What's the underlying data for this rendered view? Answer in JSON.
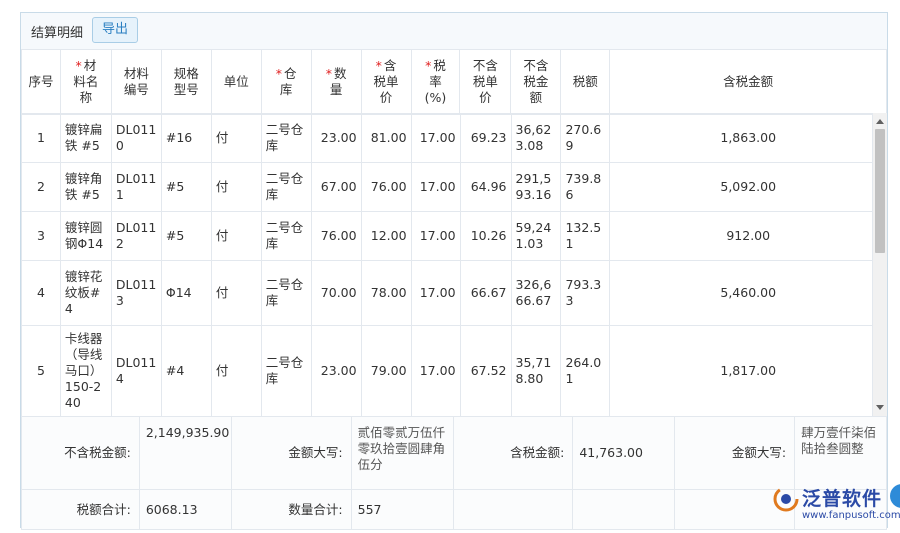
{
  "toolbar": {
    "title": "结算明细",
    "export_label": "导出"
  },
  "columns": [
    {
      "key": "seq",
      "label": "序号",
      "required": false
    },
    {
      "key": "name",
      "label": "材\n料名\n称",
      "required": true
    },
    {
      "key": "code",
      "label": "材料\n编号",
      "required": false
    },
    {
      "key": "spec",
      "label": "规格\n型号",
      "required": false
    },
    {
      "key": "unit",
      "label": "单位",
      "required": false
    },
    {
      "key": "warehouse",
      "label": "仓\n库",
      "required": true
    },
    {
      "key": "qty",
      "label": "数\n量",
      "required": true
    },
    {
      "key": "price_tax",
      "label": "含\n税单\n价",
      "required": true
    },
    {
      "key": "tax_rate",
      "label": "税\n率\n(%)",
      "required": true
    },
    {
      "key": "price_notax",
      "label": "不含\n税单\n价",
      "required": false
    },
    {
      "key": "amount_notax",
      "label": "不含\n税金\n额",
      "required": false
    },
    {
      "key": "tax",
      "label": "税额",
      "required": false
    },
    {
      "key": "amount_tax",
      "label": "含税金额",
      "required": false
    }
  ],
  "rows": [
    {
      "seq": "1",
      "name": "镀锌扁\n铁 #5",
      "code": "DL011\n0",
      "spec": "#16",
      "unit": "付",
      "warehouse": "二号仓\n库",
      "qty": "23.00",
      "price_tax": "81.00",
      "tax_rate": "17.00",
      "price_notax": "69.23",
      "amount_notax": "36,62\n3.08",
      "tax": "270.6\n9",
      "amount_tax": "1,863.00"
    },
    {
      "seq": "2",
      "name": "镀锌角\n铁 #5",
      "code": "DL011\n1",
      "spec": "#5",
      "unit": "付",
      "warehouse": "二号仓\n库",
      "qty": "67.00",
      "price_tax": "76.00",
      "tax_rate": "17.00",
      "price_notax": "64.96",
      "amount_notax": "291,5\n93.16",
      "tax": "739.8\n6",
      "amount_tax": "5,092.00"
    },
    {
      "seq": "3",
      "name": "镀锌圆\n钢Φ14",
      "code": "DL011\n2",
      "spec": "#5",
      "unit": "付",
      "warehouse": "二号仓\n库",
      "qty": "76.00",
      "price_tax": "12.00",
      "tax_rate": "17.00",
      "price_notax": "10.26",
      "amount_notax": "59,24\n1.03",
      "tax": "132.5\n1",
      "amount_tax": "912.00"
    },
    {
      "seq": "4",
      "name": "镀锌花\n纹板#\n4",
      "code": "DL011\n3",
      "spec": "Φ14",
      "unit": "付",
      "warehouse": "二号仓\n库",
      "qty": "70.00",
      "price_tax": "78.00",
      "tax_rate": "17.00",
      "price_notax": "66.67",
      "amount_notax": "326,6\n66.67",
      "tax": "793.3\n3",
      "amount_tax": "5,460.00"
    },
    {
      "seq": "5",
      "name": "卡线器\n（导线\n马口）\n150-2\n40",
      "code": "DL011\n4",
      "spec": "#4",
      "unit": "付",
      "warehouse": "二号仓\n库",
      "qty": "23.00",
      "price_tax": "79.00",
      "tax_rate": "17.00",
      "price_notax": "67.52",
      "amount_notax": "35,71\n8.80",
      "tax": "264.0\n1",
      "amount_tax": "1,817.00"
    }
  ],
  "summary": {
    "notax_label": "不含税金额:",
    "notax_value": "2,149,935.90",
    "caps1_label": "金额大写:",
    "caps1_value": "贰佰零贰万伍仟零玖拾壹圆肆角伍分",
    "tax_amount_label": "含税金额:",
    "tax_amount_value": "41,763.00",
    "caps2_label": "金额大写:",
    "caps2_value": "肆万壹仟柒佰陆拾叁圆整",
    "tax_total_label": "税额合计:",
    "tax_total_value": "6068.13",
    "qty_total_label": "数量合计:",
    "qty_total_value": "557"
  },
  "logo": {
    "name": "泛普软件",
    "url": "www.fanpusoft.com"
  },
  "colors": {
    "accent": "#2a7fc1",
    "required": "#e02020",
    "brand": "#2b4aa6"
  }
}
